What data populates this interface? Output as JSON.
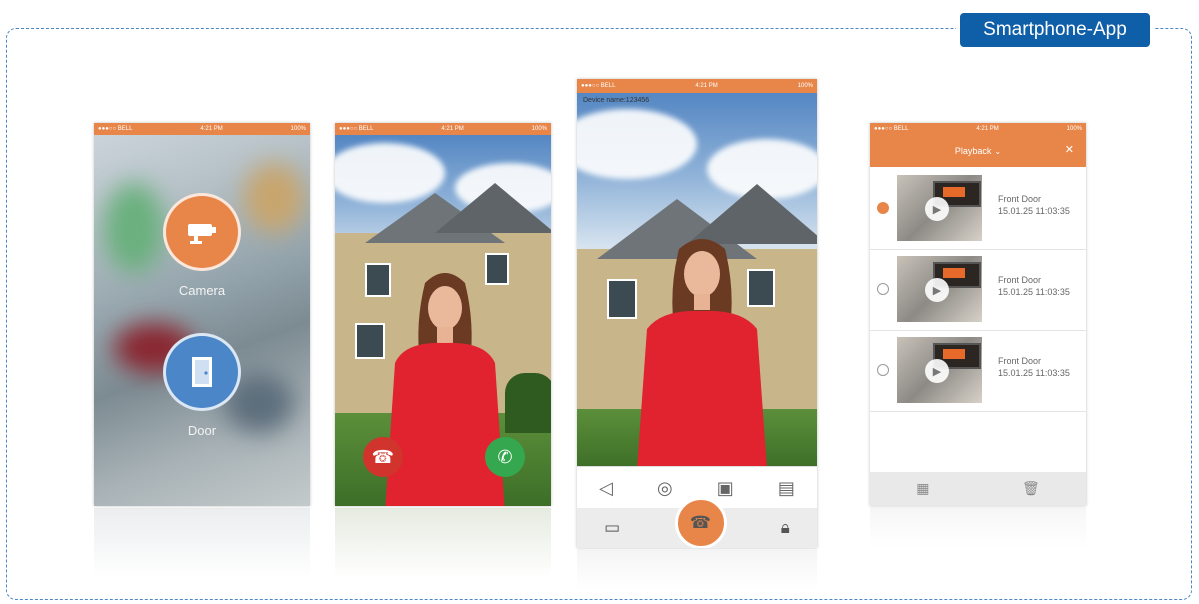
{
  "badge": {
    "label": "Smartphone-App"
  },
  "status": {
    "carrier": "●●●○○ BELL",
    "time": "4:21 PM",
    "battery": "100%"
  },
  "phone1": {
    "camera_label": "Camera",
    "door_label": "Door"
  },
  "phone3": {
    "device_name": "Device name:123456"
  },
  "phone4": {
    "title": "Playback",
    "close": "✕",
    "entries": [
      {
        "name": "Front Door",
        "datetime": "15.01.25 11:03:35"
      },
      {
        "name": "Front Door",
        "datetime": "15.01.25 11:03:35"
      },
      {
        "name": "Front Door",
        "datetime": "15.01.25 11:03:35"
      }
    ]
  },
  "icons": {
    "speaker": "speaker-icon",
    "snapshot": "camera-icon",
    "record": "video-record-icon",
    "gallery": "picture-icon",
    "video_list": "video-list-icon",
    "hangup": "hang-up-icon",
    "lock": "lock-icon",
    "select_all": "select-all-icon",
    "delete": "trash-icon"
  },
  "colors": {
    "accent": "#e8864a",
    "badge": "#0f5ea8",
    "door": "#4a86c8",
    "answer": "#35a84f",
    "reject": "#d0342c"
  }
}
